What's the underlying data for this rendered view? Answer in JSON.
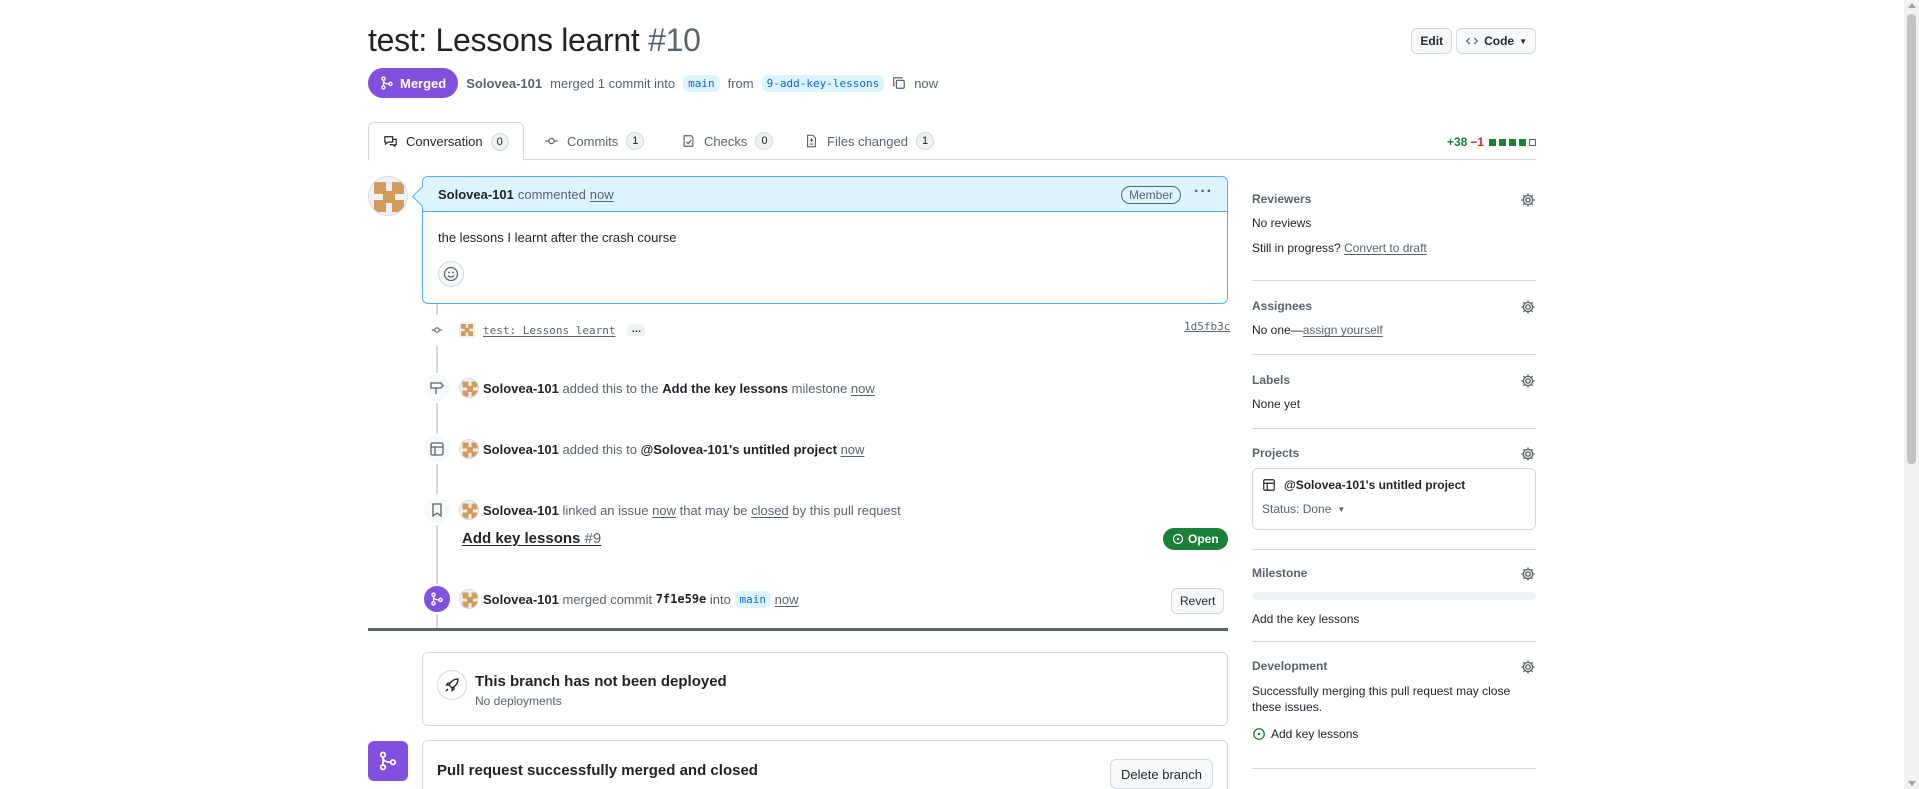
{
  "pr": {
    "title": "test: Lessons learnt",
    "number": "#10",
    "state": "Merged",
    "author": "Solovea-101",
    "meta_text": "merged 1 commit into",
    "base_branch": "main",
    "from_word": "from",
    "head_branch": "9-add-key-lessons",
    "time": "now"
  },
  "header": {
    "edit_label": "Edit",
    "code_label": "Code"
  },
  "tabs": [
    {
      "label": "Conversation",
      "count": "0"
    },
    {
      "label": "Commits",
      "count": "1"
    },
    {
      "label": "Checks",
      "count": "0"
    },
    {
      "label": "Files changed",
      "count": "1"
    }
  ],
  "diffstat": {
    "additions": "+38",
    "deletions": "−1"
  },
  "comment": {
    "author": "Solovea-101",
    "action": "commented",
    "time": "now",
    "role": "Member",
    "body": "the lessons I learnt after the crash course"
  },
  "timeline": {
    "commit": {
      "message": "test: Lessons learnt",
      "sha": "1d5fb3c",
      "more": "…"
    },
    "milestone_event": {
      "author": "Solovea-101",
      "text1": "added this to the",
      "milestone": "Add the key lessons",
      "text2": "milestone",
      "time": "now"
    },
    "project_event": {
      "author": "Solovea-101",
      "text1": "added this to",
      "project": "@Solovea-101's untitled project",
      "time": "now"
    },
    "issue_event": {
      "author": "Solovea-101",
      "text1": "linked an issue",
      "time": "now",
      "text2": "that may be",
      "closed_word": "closed",
      "text3": "by this pull request",
      "issue_title": "Add key lessons",
      "issue_number": "#9",
      "issue_state": "Open"
    },
    "merge_event": {
      "author": "Solovea-101",
      "text1": "merged commit",
      "sha": "7f1e59e",
      "text2": "into",
      "branch": "main",
      "time": "now",
      "revert_label": "Revert"
    }
  },
  "deploy": {
    "title": "This branch has not been deployed",
    "subtitle": "No deployments"
  },
  "merged_box": {
    "title": "Pull request successfully merged and closed",
    "delete_label": "Delete branch"
  },
  "sidebar": {
    "reviewers": {
      "heading": "Reviewers",
      "value": "No reviews",
      "draft_prefix": "Still in progress?",
      "draft_link": "Convert to draft"
    },
    "assignees": {
      "heading": "Assignees",
      "value_prefix": "No one—",
      "value_link": "assign yourself"
    },
    "labels": {
      "heading": "Labels",
      "value": "None yet"
    },
    "projects": {
      "heading": "Projects",
      "project_name": "@Solovea-101's untitled project",
      "status": "Status: Done"
    },
    "milestone": {
      "heading": "Milestone",
      "name": "Add the key lessons",
      "progress": 0
    },
    "development": {
      "heading": "Development",
      "text": "Successfully merging this pull request may close these issues.",
      "issue": "Add key lessons"
    }
  },
  "colors": {
    "merged": "#8250df",
    "open": "#1a7f37",
    "accent_blue": "#0969da",
    "comment_header": "#ddf4ff"
  }
}
